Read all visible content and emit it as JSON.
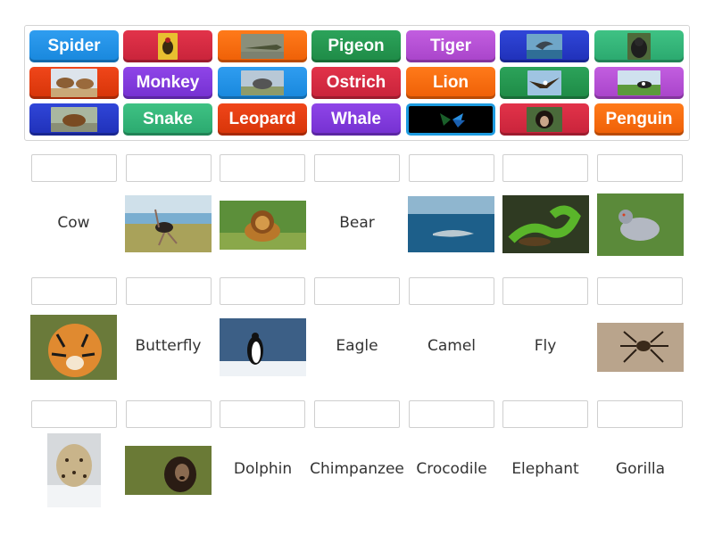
{
  "bank": {
    "tiles": [
      {
        "label": "Spider",
        "color": "blue"
      },
      {
        "label": "",
        "color": "red",
        "image": "fly-image"
      },
      {
        "label": "",
        "color": "orange",
        "image": "crocodile-image"
      },
      {
        "label": "Pigeon",
        "color": "green"
      },
      {
        "label": "Tiger",
        "color": "purple"
      },
      {
        "label": "",
        "color": "navy",
        "image": "dolphin-image"
      },
      {
        "label": "",
        "color": "mint",
        "image": "gorilla-image"
      },
      {
        "label": "",
        "color": "redorange",
        "image": "camel-image"
      },
      {
        "label": "Monkey",
        "color": "violet"
      },
      {
        "label": "",
        "color": "blue",
        "image": "elephant-image"
      },
      {
        "label": "Ostrich",
        "color": "red"
      },
      {
        "label": "Lion",
        "color": "orange"
      },
      {
        "label": "",
        "color": "green",
        "image": "eagle-image"
      },
      {
        "label": "",
        "color": "purple",
        "image": "cow-image"
      },
      {
        "label": "",
        "color": "navy",
        "image": "bear-image"
      },
      {
        "label": "Snake",
        "color": "mint"
      },
      {
        "label": "Leopard",
        "color": "redorange"
      },
      {
        "label": "Whale",
        "color": "violet"
      },
      {
        "label": "",
        "color": "black",
        "image": "butterfly-image"
      },
      {
        "label": "",
        "color": "red",
        "image": "chimpanzee-image"
      },
      {
        "label": "Penguin",
        "color": "orange"
      }
    ]
  },
  "targets": [
    {
      "text": "Cow"
    },
    {
      "image": "ostrich-photo"
    },
    {
      "image": "lion-photo"
    },
    {
      "text": "Bear"
    },
    {
      "image": "whale-photo"
    },
    {
      "image": "snake-photo"
    },
    {
      "image": "pigeon-photo"
    },
    {
      "image": "tiger-photo"
    },
    {
      "text": "Butterfly"
    },
    {
      "image": "penguin-photo"
    },
    {
      "text": "Eagle"
    },
    {
      "text": "Camel"
    },
    {
      "text": "Fly"
    },
    {
      "image": "spider-photo"
    },
    {
      "image": "leopard-photo"
    },
    {
      "image": "monkey-photo"
    },
    {
      "text": "Dolphin"
    },
    {
      "text": "Chimpanzee"
    },
    {
      "text": "Crocodile"
    },
    {
      "text": "Elephant"
    },
    {
      "text": "Gorilla"
    }
  ]
}
